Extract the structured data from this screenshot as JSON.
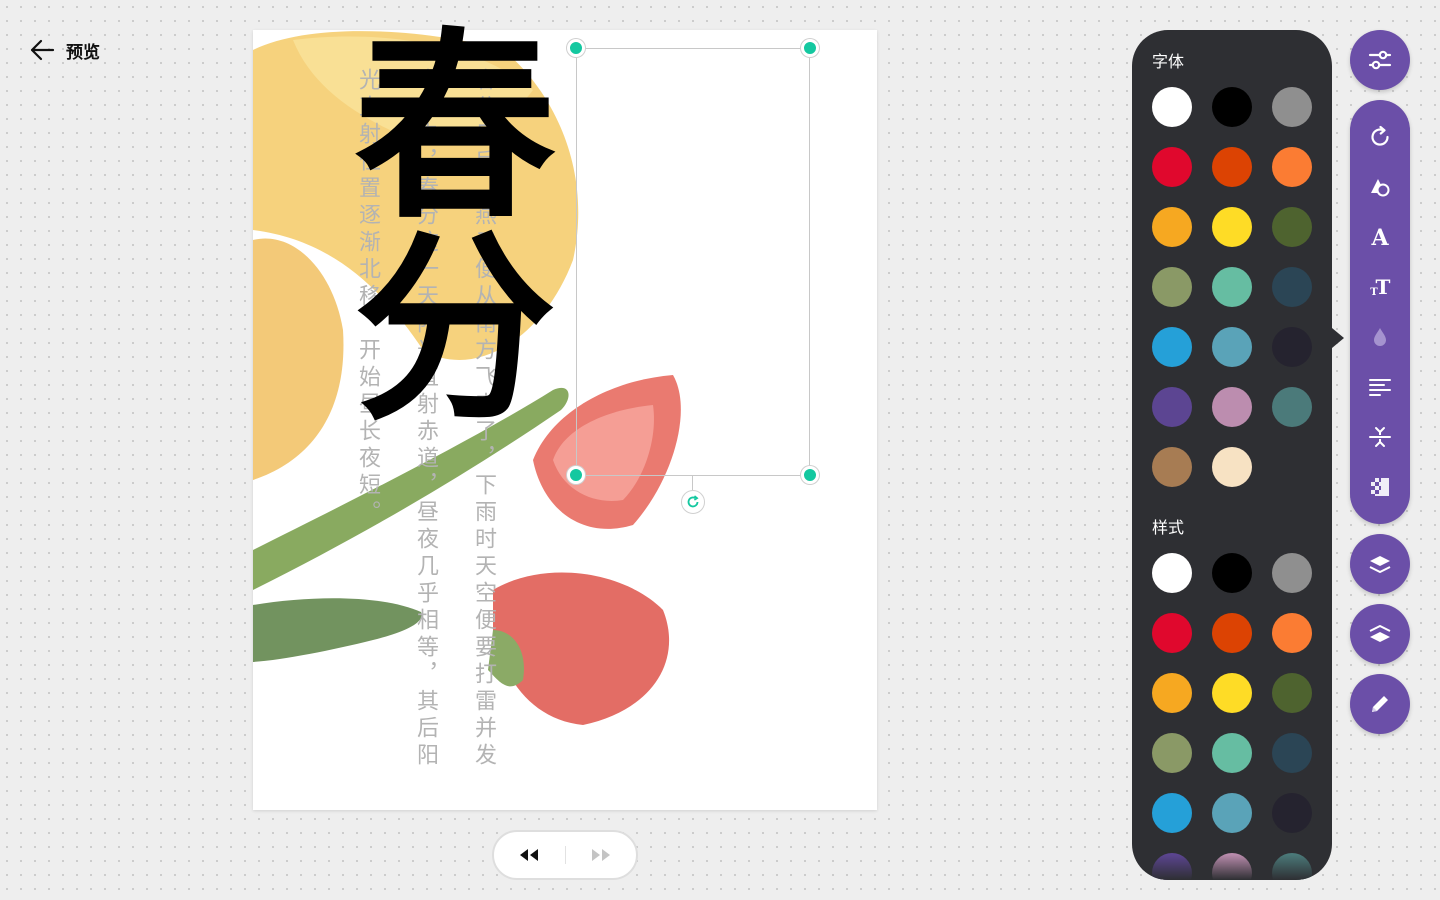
{
  "header": {
    "back_label": "预览"
  },
  "page": {
    "title_text": "春分",
    "body_text": "春分日后，燕子便从南方飞来了，下雨时天空便要打雷并发出闪电，春分这一天阳光直射赤道，昼夜几乎相等，其后阳光直射位置逐渐北移，开始昼长夜短。"
  },
  "panel": {
    "font_title": "字体",
    "style_title": "样式",
    "font_colors": [
      "#ffffff",
      "#000000",
      "#8f8f8f",
      "#e0082d",
      "#dc4303",
      "#fb7c33",
      "#f6a821",
      "#fedc26",
      "#4e632f",
      "#8a9966",
      "#66bda2",
      "#2b4555",
      "#25a0d8",
      "#5aa3b8",
      "#25232f",
      "#5c4592",
      "#bc8daf",
      "#4b7a7a",
      "#a77c53",
      "#f7e2c3"
    ],
    "style_colors": [
      "#ffffff",
      "#000000",
      "#8f8f8f",
      "#e0082d",
      "#dc4303",
      "#fb7c33",
      "#f6a821",
      "#fedc26",
      "#4e632f",
      "#8a9966",
      "#66bda2",
      "#2b4555",
      "#25a0d8",
      "#5aa3b8",
      "#25232f",
      "#5c4592",
      "#bc8daf",
      "#4b7a7a"
    ]
  },
  "tools": [
    {
      "icon": "sliders-icon"
    },
    {
      "icon": "rotate-icon"
    },
    {
      "icon": "shape-icon"
    },
    {
      "icon": "font-icon"
    },
    {
      "icon": "text-size-icon"
    },
    {
      "icon": "opacity-drop-icon"
    },
    {
      "icon": "align-left-icon"
    },
    {
      "icon": "line-spacing-icon"
    },
    {
      "icon": "transparency-icon"
    },
    {
      "icon": "layer-up-icon"
    },
    {
      "icon": "layer-down-icon"
    },
    {
      "icon": "edit-pencil-icon"
    }
  ],
  "colors": {
    "accent": "#6b4fa8",
    "panel_bg": "#2e2f33",
    "handle": "#14c8a0"
  }
}
